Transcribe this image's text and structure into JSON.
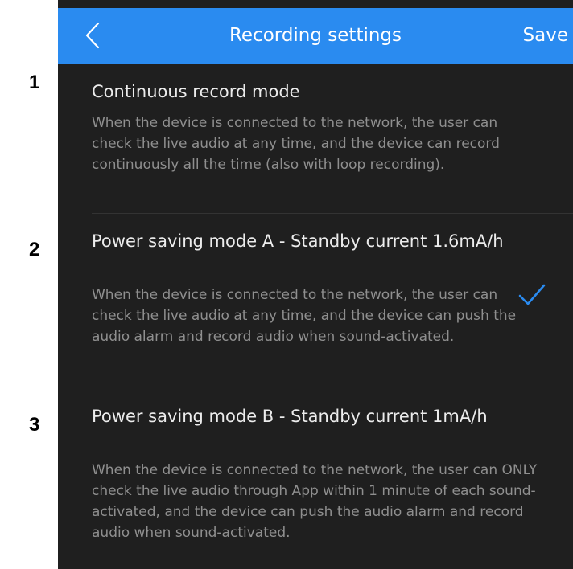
{
  "step_numbers": [
    "1",
    "2",
    "3"
  ],
  "header": {
    "back_icon": "chevron-left-icon",
    "title": "Recording settings",
    "save_label": "Save"
  },
  "modes": [
    {
      "title": "Continuous record mode",
      "description": "When the device is connected to the network, the user can check the live audio at any time, and the device can record continuously all the time (also with loop recording).",
      "selected": false
    },
    {
      "title": "Power saving mode A - Standby current 1.6mA/h",
      "description": "When the device is connected to the network, the user can check the live audio at any time, and the device can push the audio alarm and record audio when sound-activated.",
      "selected": true
    },
    {
      "title": "Power saving mode B - Standby current 1mA/h",
      "description": "When the device is connected to the network, the user can ONLY check the live audio through App within 1 minute of each sound-activated, and the device can push the audio alarm and record audio when sound-activated.",
      "selected": false
    }
  ],
  "icons": {
    "selected": "check-icon"
  },
  "colors": {
    "header_bg": "#2a8bf0",
    "screen_bg": "#1f1f1f",
    "title_text": "#ececec",
    "description_text": "#8f8f8f",
    "check_mark": "#2a8bf0"
  }
}
